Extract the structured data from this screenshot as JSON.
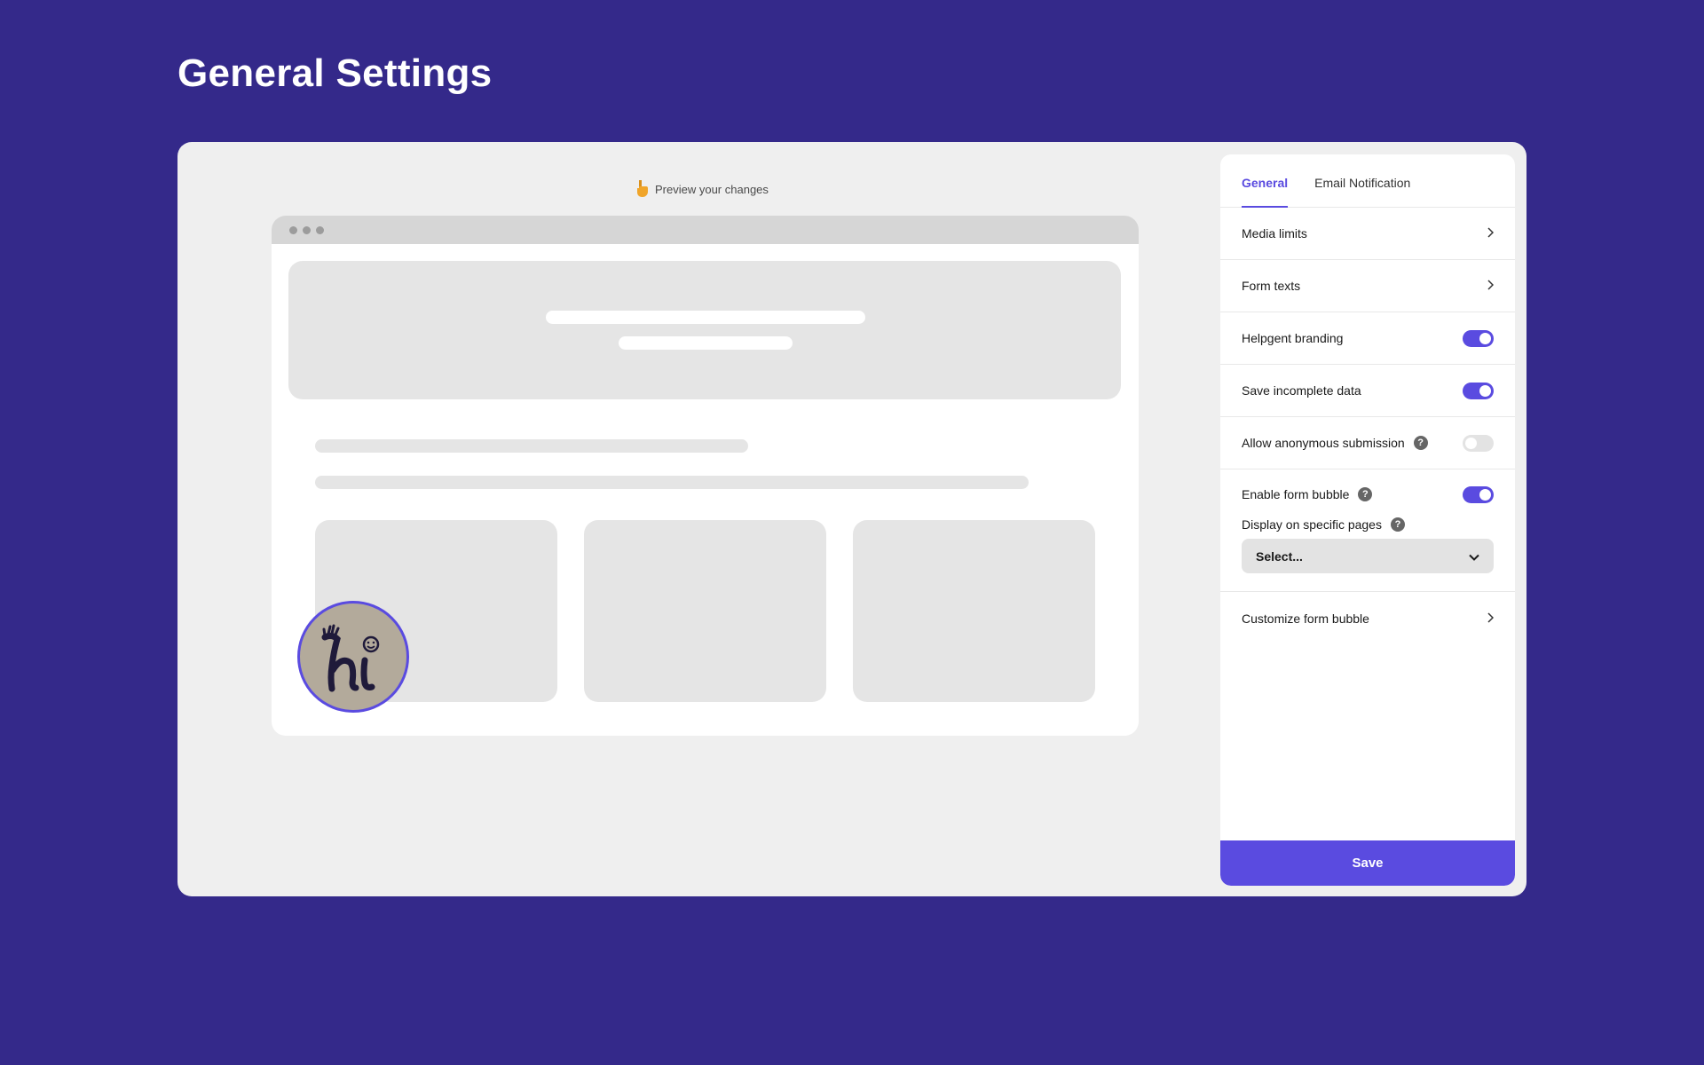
{
  "page": {
    "title": "General Settings"
  },
  "preview": {
    "caption": "Preview your changes",
    "caption_icon": "pointing-hand-icon",
    "bubble_text": "hi"
  },
  "tabs": [
    {
      "label": "General",
      "active": true
    },
    {
      "label": "Email Notification",
      "active": false
    }
  ],
  "settings": {
    "media_limits": "Media limits",
    "form_texts": "Form texts",
    "branding": {
      "label": "Helpgent branding",
      "enabled": true
    },
    "save_incomplete": {
      "label": "Save incomplete data",
      "enabled": true
    },
    "anonymous": {
      "label": "Allow anonymous submission",
      "enabled": false
    },
    "form_bubble": {
      "label": "Enable form bubble",
      "enabled": true
    },
    "specific_pages": {
      "label": "Display on specific pages",
      "value": "Select..."
    },
    "customize_bubble": "Customize form bubble"
  },
  "save_label": "Save",
  "colors": {
    "background": "#34298a",
    "accent": "#5a4be0",
    "toggle_off": "#e3e3e3"
  }
}
